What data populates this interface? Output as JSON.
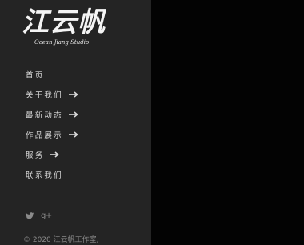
{
  "logo": {
    "brush_text": "江云帆",
    "subtitle": "Ocean Jiang Studio"
  },
  "nav": {
    "items": [
      {
        "label": "首页",
        "has_arrow": false
      },
      {
        "label": "关于我们",
        "has_arrow": true
      },
      {
        "label": "最新动态",
        "has_arrow": true
      },
      {
        "label": "作品展示",
        "has_arrow": true
      },
      {
        "label": "服务",
        "has_arrow": true
      },
      {
        "label": "联系我们",
        "has_arrow": false
      }
    ],
    "arrow_icon": "arrow-right-icon"
  },
  "social": {
    "icons": [
      "twitter-icon",
      "google-plus-icon"
    ],
    "google_plus_text": "g+"
  },
  "footer": {
    "copyright_prefix": "© 2020 ",
    "copyright_link": "江云帆工作室,"
  },
  "colors": {
    "sidebar_bg": "#242424",
    "main_bg": "#030303",
    "nav_text": "#dadada",
    "muted_text": "#8c8c8c"
  }
}
